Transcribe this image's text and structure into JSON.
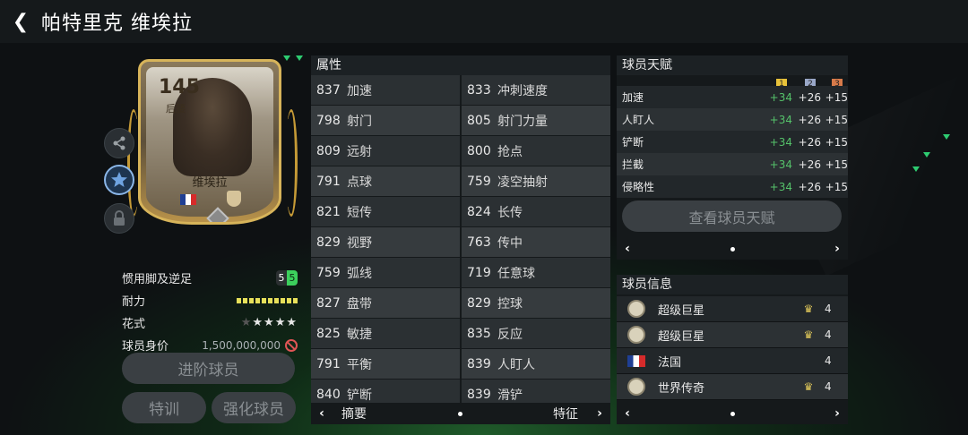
{
  "header": {
    "back_icon": "chevron-left-icon",
    "title": "帕特里克 维埃拉"
  },
  "card": {
    "rating": "145",
    "position": "后腰",
    "name": "维埃拉",
    "nation_flag_colors": [
      "#1f3f94",
      "#ffffff",
      "#d62b2b"
    ]
  },
  "side_actions": [
    {
      "icon": "share-icon"
    },
    {
      "icon": "star-icon"
    },
    {
      "icon": "lock-icon"
    }
  ],
  "player_stats": {
    "foot_label": "惯用脚及逆足",
    "foot_primary": "5",
    "foot_weak": "5",
    "stamina_label": "耐力",
    "stamina_segments": 10,
    "skill_label": "花式",
    "skill_stars_filled": 4,
    "skill_stars_total": 5,
    "value_label": "球员身价",
    "value": "1,500,000,000"
  },
  "buttons": {
    "advance": "进阶球员",
    "train": "特训",
    "enhance": "强化球员"
  },
  "attributes": {
    "title": "属性",
    "rows": [
      [
        {
          "value": "837",
          "name": "加速"
        },
        {
          "value": "833",
          "name": "冲刺速度"
        }
      ],
      [
        {
          "value": "798",
          "name": "射门"
        },
        {
          "value": "805",
          "name": "射门力量"
        }
      ],
      [
        {
          "value": "809",
          "name": "远射"
        },
        {
          "value": "800",
          "name": "抢点"
        }
      ],
      [
        {
          "value": "791",
          "name": "点球"
        },
        {
          "value": "759",
          "name": "凌空抽射"
        }
      ],
      [
        {
          "value": "821",
          "name": "短传"
        },
        {
          "value": "824",
          "name": "长传"
        }
      ],
      [
        {
          "value": "829",
          "name": "视野"
        },
        {
          "value": "763",
          "name": "传中"
        }
      ],
      [
        {
          "value": "759",
          "name": "弧线"
        },
        {
          "value": "719",
          "name": "任意球"
        }
      ],
      [
        {
          "value": "827",
          "name": "盘带"
        },
        {
          "value": "829",
          "name": "控球"
        }
      ],
      [
        {
          "value": "825",
          "name": "敏捷"
        },
        {
          "value": "835",
          "name": "反应"
        }
      ],
      [
        {
          "value": "791",
          "name": "平衡"
        },
        {
          "value": "839",
          "name": "人盯人"
        }
      ],
      [
        {
          "value": "840",
          "name": "铲断"
        },
        {
          "value": "839",
          "name": "滑铲"
        }
      ]
    ],
    "footer": {
      "prev": "‹",
      "left_label": "摘要",
      "right_label": "特征",
      "next": "›"
    }
  },
  "talents": {
    "title": "球员天赋",
    "tiers": [
      "1",
      "2",
      "3"
    ],
    "rows": [
      {
        "name": "加速",
        "v1": "+34",
        "v2": "+26",
        "v3": "+15"
      },
      {
        "name": "人盯人",
        "v1": "+34",
        "v2": "+26",
        "v3": "+15"
      },
      {
        "name": "铲断",
        "v1": "+34",
        "v2": "+26",
        "v3": "+15"
      },
      {
        "name": "拦截",
        "v1": "+34",
        "v2": "+26",
        "v3": "+15"
      },
      {
        "name": "侵略性",
        "v1": "+34",
        "v2": "+26",
        "v3": "+15"
      }
    ],
    "button": "查看球员天赋",
    "prev": "‹",
    "next": "›"
  },
  "info": {
    "title": "球员信息",
    "rows": [
      {
        "icon": "badge-icon",
        "name": "超级巨星",
        "crown": true,
        "num": "4"
      },
      {
        "icon": "badge-icon",
        "name": "超级巨星",
        "crown": true,
        "num": "4"
      },
      {
        "icon": "flag-icon",
        "name": "法国",
        "crown": false,
        "num": "4"
      },
      {
        "icon": "badge-icon",
        "name": "世界传奇",
        "crown": true,
        "num": "4"
      }
    ],
    "prev": "‹",
    "next": "›"
  },
  "colors": {
    "accent_green": "#55c26a",
    "stamina": "#e7e05a",
    "panel": "#15191b"
  }
}
